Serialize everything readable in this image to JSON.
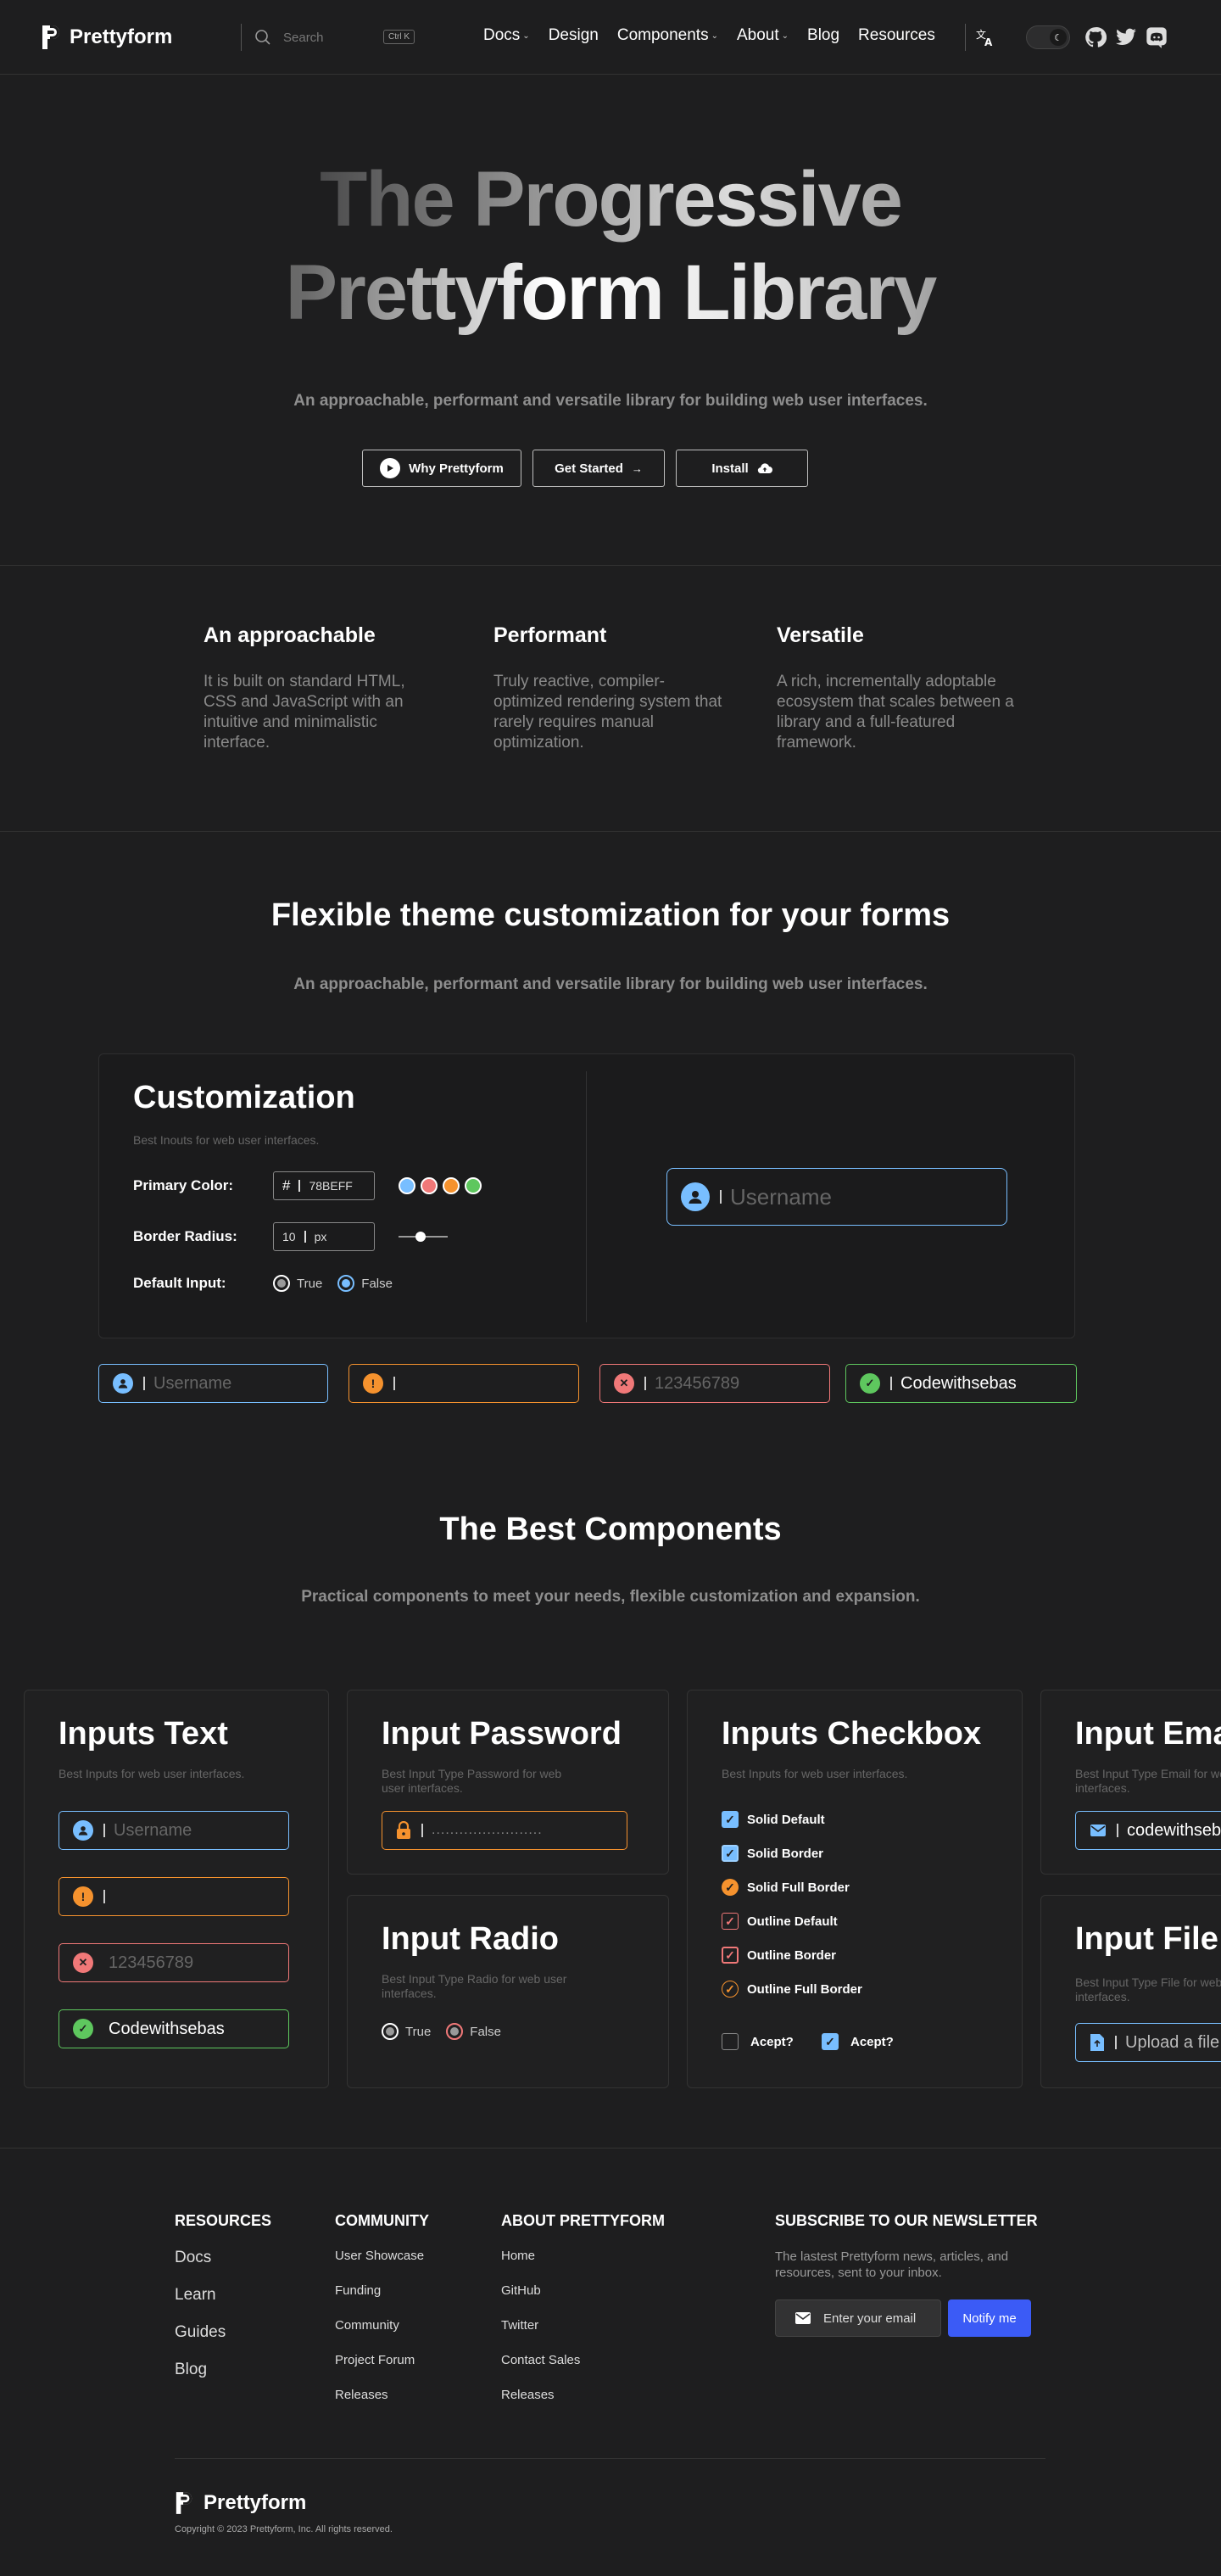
{
  "header": {
    "brand": "Prettyform",
    "search_placeholder": "Search",
    "search_shortcut": "Ctrl K",
    "nav": [
      {
        "label": "Docs",
        "dropdown": true
      },
      {
        "label": "Design",
        "dropdown": false
      },
      {
        "label": "Components",
        "dropdown": true
      },
      {
        "label": "About",
        "dropdown": true
      },
      {
        "label": "Blog",
        "dropdown": false
      },
      {
        "label": "Resources",
        "dropdown": false
      }
    ],
    "icons": [
      "translate-icon",
      "theme-toggle",
      "github-icon",
      "twitter-icon",
      "discord-icon"
    ]
  },
  "hero": {
    "title_line1": "The Progressive",
    "title_line2": "Prettyform Library",
    "subtitle": "An approachable, performant and versatile library for building web user interfaces.",
    "buttons": [
      "Why Prettyform",
      "Get Started",
      "Install"
    ]
  },
  "features": [
    {
      "title": "An approachable",
      "text": "It is built on standard HTML, CSS and JavaScript with an intuitive and minimalistic interface."
    },
    {
      "title": "Performant",
      "text": "Truly reactive, compiler-optimized rendering system that rarely requires manual optimization."
    },
    {
      "title": "Versatile",
      "text": "A rich, incrementally adoptable ecosystem that scales between a library and a full-featured framework."
    }
  ],
  "theme": {
    "title": "Flexible theme customization for your forms",
    "subtitle": "An approachable, performant and versatile library for building web user interfaces.",
    "panel": {
      "title": "Customization",
      "subtitle": "Best Inouts for web user interfaces.",
      "primary_color_label": "Primary Color:",
      "primary_color_hash": "#",
      "primary_color_value": "78BEFF",
      "swatches": [
        "#78beff",
        "#f07878",
        "#f5922e",
        "#5ec75e"
      ],
      "border_radius_label": "Border Radius:",
      "border_radius_value": "10",
      "border_radius_unit": "px",
      "default_input_label": "Default Input:",
      "radio_true": "True",
      "radio_false": "False",
      "preview_placeholder": "Username"
    },
    "row_inputs": [
      {
        "state": "info",
        "text": "Username",
        "color": "#78beff"
      },
      {
        "state": "warning",
        "text": "",
        "color": "#f5922e"
      },
      {
        "state": "error",
        "text": "123456789",
        "color": "#f07878"
      },
      {
        "state": "success",
        "text": "Codewithsebas",
        "color": "#5ec75e"
      }
    ]
  },
  "components": {
    "title": "The Best Components",
    "subtitle": "Practical components to meet your needs, flexible customization and expansion.",
    "inputs_text": {
      "title": "Inputs Text",
      "subtitle": "Best Inputs for web user interfaces.",
      "fields": [
        "Username",
        "",
        "123456789",
        "Codewithsebas"
      ]
    },
    "input_password": {
      "title": "Input Password",
      "subtitle": "Best Input Type Password for web user interfaces.",
      "value": "........................"
    },
    "input_radio": {
      "title": "Input Radio",
      "subtitle": "Best Input Type Radio for web user interfaces.",
      "options": [
        "True",
        "False"
      ]
    },
    "inputs_checkbox": {
      "title": "Inputs Checkbox",
      "subtitle": "Best Inputs for web user interfaces.",
      "items": [
        "Solid Default",
        "Solid Border",
        "Solid Full Border",
        "Outline Default",
        "Outline Border",
        "Outline Full Border"
      ],
      "accept_unchecked": "Acept?",
      "accept_checked": "Acept?"
    },
    "input_email": {
      "title": "Input Email",
      "subtitle": "Best Input Type Email for web user interfaces.",
      "value": "codewithsebas"
    },
    "input_file": {
      "title": "Input File",
      "subtitle": "Best Input Type File for web user interfaces.",
      "value": "Upload a file"
    }
  },
  "footer": {
    "resources": {
      "heading": "RESOURCES",
      "links": [
        "Docs",
        "Learn",
        "Guides",
        "Blog"
      ]
    },
    "community": {
      "heading": "COMMUNITY",
      "links": [
        "User Showcase",
        "Funding",
        "Community",
        "Project Forum",
        "Releases"
      ]
    },
    "about": {
      "heading": "ABOUT PRETTYFORM",
      "links": [
        "Home",
        "GitHub",
        "Twitter",
        "Contact Sales",
        "Releases"
      ]
    },
    "newsletter": {
      "heading": "SUBSCRIBE TO OUR NEWSLETTER",
      "text": "The lastest Prettyform news, articles, and resources, sent to your inbox.",
      "placeholder": "Enter your email",
      "button": "Notify me"
    },
    "brand": "Prettyform",
    "copyright": "Copyright © 2023 Prettyform, Inc. All rights reserved."
  },
  "colors": {
    "info": "#78beff",
    "warning": "#f5922e",
    "error": "#f07878",
    "success": "#5ec75e",
    "notify": "#3b5bf6"
  }
}
